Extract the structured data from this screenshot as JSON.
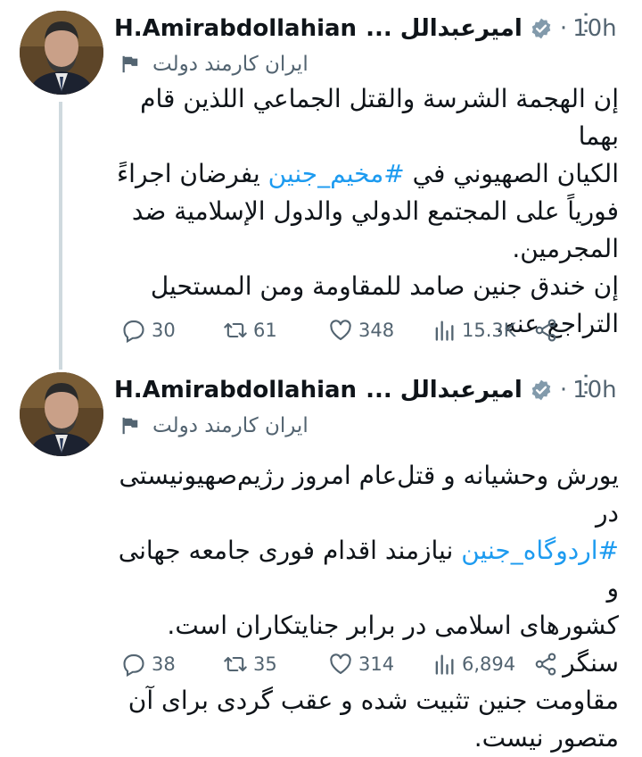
{
  "tweets": [
    {
      "author": {
        "name_en": "H.Amirabdollahian",
        "name_fa": "امیرعبدالل ...",
        "affiliation": "ایران کارمند دولت"
      },
      "timestamp": "10h",
      "body": {
        "line1": "إن الهجمة الشرسة والقتل الجماعي اللذين قام بهما",
        "line2_prefix": "الكيان الصهيوني في ",
        "hashtag": "#مخيم_جنين",
        "line2_suffix": " يفرضان اجراءً",
        "line3": "فورياً على المجتمع الدولي والدول الإسلامية ضد",
        "line4": "المجرمين.",
        "line5": "إن خندق جنين صامد للمقاومة ومن المستحيل",
        "line6": "التراجع عنه."
      },
      "stats": {
        "replies": "30",
        "retweets": "61",
        "likes": "348",
        "views": "15.3K"
      }
    },
    {
      "author": {
        "name_en": "H.Amirabdollahian",
        "name_fa": "امیرعبدالل ...",
        "affiliation": "ایران کارمند دولت"
      },
      "timestamp": "10h",
      "body": {
        "line1": "یورش وحشیانه و قتل‌عام امروز رژیم‌صهیونیستی در",
        "hashtag": "#اردوگاه_جنین",
        "line2_suffix": " نیازمند اقدام فوری جامعه جهانی و",
        "line3": "کشورهای اسلامی در برابر جنایتکاران است. سنگر",
        "line4": "مقاومت جنین تثبیت شده و عقب گردی برای آن",
        "line5": "متصور نیست."
      },
      "stats": {
        "replies": "38",
        "retweets": "35",
        "likes": "314",
        "views": "6,894"
      }
    }
  ],
  "icons": {
    "verified": "verified-badge-icon",
    "affiliation": "flag-icon",
    "more": "more-icon",
    "reply": "reply-icon",
    "retweet": "retweet-icon",
    "like": "heart-icon",
    "views": "views-icon",
    "share": "share-icon"
  },
  "colors": {
    "hashtag": "#1d9bf0",
    "secondary_text": "#536471",
    "primary_text": "#0f1419",
    "verified_badge": "#829aab",
    "thread_line": "#cfd9de"
  }
}
